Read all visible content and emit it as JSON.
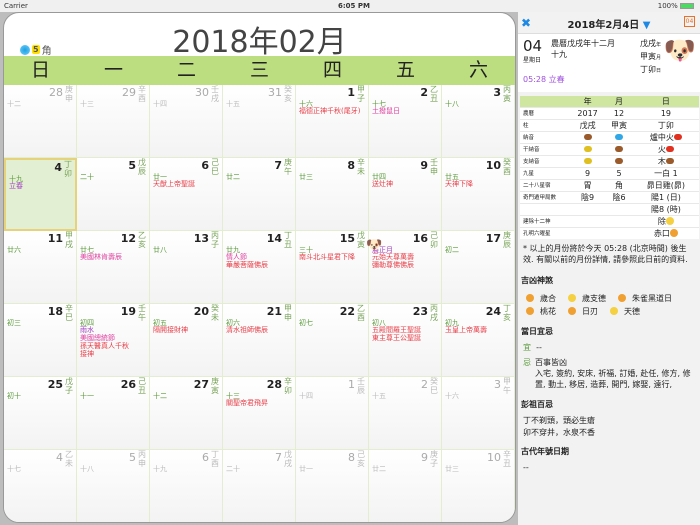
{
  "status": {
    "carrier": "Carrier",
    "time": "6:05 PM",
    "battery": "100%"
  },
  "calendar": {
    "title": "2018年02月",
    "moon_star": "5",
    "moon_mansion": "角",
    "weekdays": [
      "日",
      "一",
      "二",
      "三",
      "四",
      "五",
      "六"
    ],
    "colors": {
      "festival": "#e8404a",
      "western": "#e040a0",
      "solar": "#a040c0",
      "accent": "#bcdd80"
    },
    "cells": [
      {
        "d": "28",
        "gz": "庚申",
        "l": "十二",
        "o": true
      },
      {
        "d": "29",
        "gz": "辛酉",
        "l": "十三",
        "o": true
      },
      {
        "d": "30",
        "gz": "壬戌",
        "l": "十四",
        "o": true
      },
      {
        "d": "31",
        "gz": "癸亥",
        "l": "十五",
        "o": true
      },
      {
        "d": "1",
        "gz": "甲子",
        "l": "十六",
        "e": [
          [
            "福德正神千秋(尾牙)",
            "festival"
          ]
        ]
      },
      {
        "d": "2",
        "gz": "乙丑",
        "l": "十七",
        "e": [
          [
            "土撥鼠日",
            "western"
          ]
        ]
      },
      {
        "d": "3",
        "gz": "丙寅",
        "l": "十八"
      },
      {
        "d": "4",
        "gz": "丁卯",
        "l": "十九",
        "e": [
          [
            "立春",
            "solar"
          ]
        ],
        "t": true
      },
      {
        "d": "5",
        "gz": "戊辰",
        "l": "二十"
      },
      {
        "d": "6",
        "gz": "己巳",
        "l": "廿一",
        "e": [
          [
            "天猷上帝聖誕",
            "festival"
          ]
        ]
      },
      {
        "d": "7",
        "gz": "庚午",
        "l": "廿二"
      },
      {
        "d": "8",
        "gz": "辛未",
        "l": "廿三"
      },
      {
        "d": "9",
        "gz": "壬申",
        "l": "廿四",
        "e": [
          [
            "送灶神",
            "festival"
          ]
        ]
      },
      {
        "d": "10",
        "gz": "癸酉",
        "l": "廿五",
        "e": [
          [
            "天神下降",
            "festival"
          ]
        ]
      },
      {
        "d": "11",
        "gz": "甲戌",
        "l": "廿六"
      },
      {
        "d": "12",
        "gz": "乙亥",
        "l": "廿七",
        "e": [
          [
            "美國林肯壽辰",
            "western"
          ]
        ]
      },
      {
        "d": "13",
        "gz": "丙子",
        "l": "廿八"
      },
      {
        "d": "14",
        "gz": "丁丑",
        "l": "廿九",
        "e": [
          [
            "情人節",
            "western"
          ],
          [
            "華嚴菩薩佛辰",
            "festival"
          ]
        ]
      },
      {
        "d": "15",
        "gz": "戊寅",
        "l": "三十",
        "e": [
          [
            "南斗北斗星君下降",
            "festival"
          ]
        ]
      },
      {
        "d": "16",
        "gz": "己卯",
        "l": "農正月",
        "lc": "solar",
        "e": [
          [
            "元始天尊萬壽",
            "festival"
          ],
          [
            "彌勒尊佛佛辰",
            "festival"
          ]
        ]
      },
      {
        "d": "17",
        "gz": "庚辰",
        "l": "初二"
      },
      {
        "d": "18",
        "gz": "辛巳",
        "l": "初三"
      },
      {
        "d": "19",
        "gz": "壬午",
        "l": "初四",
        "e": [
          [
            "雨水",
            "solar"
          ],
          [
            "美國總統節",
            "western"
          ],
          [
            "孫天醫真人千秋",
            "festival"
          ],
          [
            "接神",
            "festival"
          ]
        ]
      },
      {
        "d": "20",
        "gz": "癸未",
        "l": "初五",
        "e": [
          [
            "隔開接財神",
            "festival"
          ]
        ]
      },
      {
        "d": "21",
        "gz": "甲申",
        "l": "初六",
        "e": [
          [
            "清水祖師佛辰",
            "festival"
          ]
        ]
      },
      {
        "d": "22",
        "gz": "乙酉",
        "l": "初七"
      },
      {
        "d": "23",
        "gz": "丙戌",
        "l": "初八",
        "e": [
          [
            "五殿閻羅王聖誕",
            "festival"
          ],
          [
            "東主尊王公聖誕",
            "festival"
          ]
        ]
      },
      {
        "d": "24",
        "gz": "丁亥",
        "l": "初九",
        "e": [
          [
            "玉皇上帝萬壽",
            "festival"
          ]
        ]
      },
      {
        "d": "25",
        "gz": "戊子",
        "l": "初十"
      },
      {
        "d": "26",
        "gz": "己丑",
        "l": "十一"
      },
      {
        "d": "27",
        "gz": "庚寅",
        "l": "十二"
      },
      {
        "d": "28",
        "gz": "辛卯",
        "l": "十三",
        "e": [
          [
            "關聖帝君飛昇",
            "festival"
          ]
        ]
      },
      {
        "d": "1",
        "gz": "壬辰",
        "l": "十四",
        "o": true
      },
      {
        "d": "2",
        "gz": "癸巳",
        "l": "十五",
        "o": true
      },
      {
        "d": "3",
        "gz": "甲午",
        "l": "十六",
        "o": true
      },
      {
        "d": "4",
        "gz": "乙未",
        "l": "十七",
        "o": true
      },
      {
        "d": "5",
        "gz": "丙申",
        "l": "十八",
        "o": true
      },
      {
        "d": "6",
        "gz": "丁酉",
        "l": "十九",
        "o": true
      },
      {
        "d": "7",
        "gz": "戊戌",
        "l": "二十",
        "o": true
      },
      {
        "d": "8",
        "gz": "己亥",
        "l": "廿一",
        "o": true
      },
      {
        "d": "9",
        "gz": "庚子",
        "l": "廿二",
        "o": true
      },
      {
        "d": "10",
        "gz": "辛丑",
        "l": "廿三",
        "o": true
      }
    ]
  },
  "side": {
    "date_title": "2018年2月4日",
    "cal_icon": "04",
    "day": "04",
    "weekday": "星期日",
    "lunar_line1": "農曆戊戌年十二月",
    "lunar_line2": "十九",
    "gz_year": "戊戌",
    "gz_month": "甲寅",
    "gz_day": "丁卯",
    "y": "年",
    "m": "月",
    "d": "日",
    "term": "05:28 立春",
    "table": {
      "headers": [
        "年",
        "月",
        "日"
      ],
      "rows": [
        [
          "農曆",
          "2017",
          "12",
          "19"
        ],
        [
          "柱",
          "戊戌",
          "甲寅",
          "丁卯"
        ],
        [
          "納音",
          "",
          "",
          "爐中火"
        ],
        [
          "干納音",
          "",
          "",
          "火"
        ],
        [
          "支納音",
          "",
          "",
          "木"
        ],
        [
          "九星",
          "9",
          "5",
          "一白 1"
        ],
        [
          "二十八星宿",
          "胃",
          "角",
          "昴日雞(昴)"
        ],
        [
          "奇門遁甲局數",
          "陰9",
          "陰6",
          "陽1 (日)"
        ],
        [
          "",
          "",
          "",
          "陽8 (時)"
        ],
        [
          "建除十二神",
          "",
          "",
          "除"
        ],
        [
          "孔明六曜星",
          "",
          "",
          "赤口"
        ]
      ]
    },
    "note": "* 以上的月份將於今天 05:28 (北京時間) 後生效. 有關以前的月份詳情, 請參照此日前的資料.",
    "jixiong_title": "吉凶神煞",
    "jixiong": [
      "歲合",
      "歲支德",
      "朱雀黑道日",
      "桃花",
      "日刃",
      "天德"
    ],
    "yiji_title": "當日宜忌",
    "yi_label": "宜",
    "yi": "--",
    "ji_label": "忌",
    "ji_head": "百事皆凶",
    "ji": "入宅, 簽約, 安床, 祈福, 訂婚, 赴任, 修方, 修置, 動土, 移居, 造葬, 開門, 嫁娶, 遠行,",
    "pengzu_title": "彭祖百忌",
    "pengzu1": "丁不剃頭，頭必生瘡",
    "pengzu2": "卯不穿井，水泉不香",
    "era_title": "古代年號日期",
    "era": "--"
  }
}
